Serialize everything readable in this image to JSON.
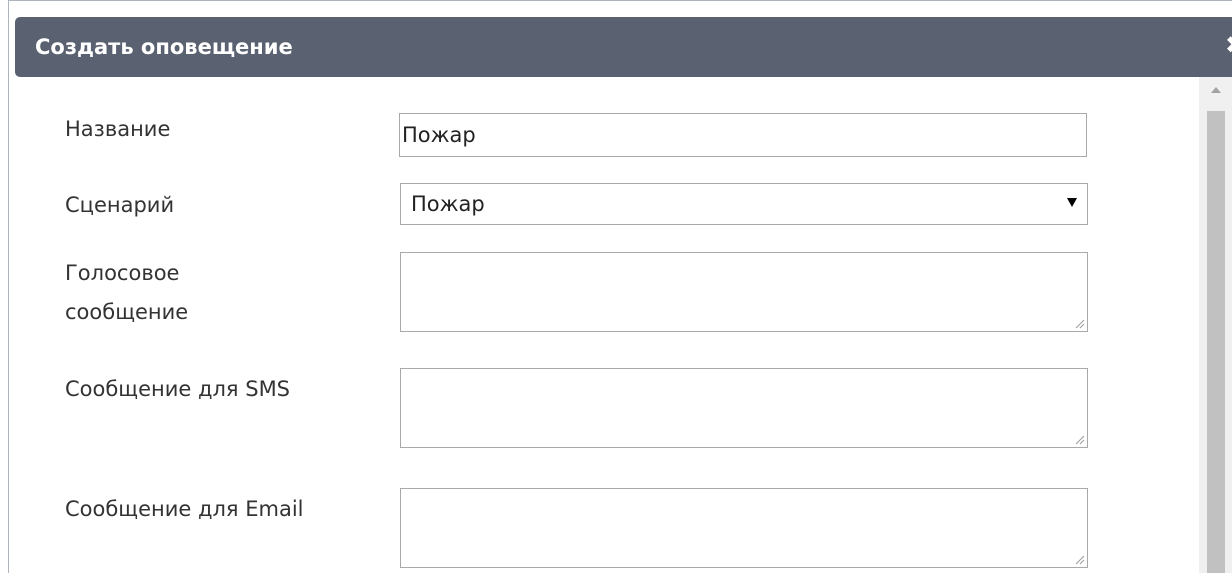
{
  "dialog": {
    "title": "Создать оповещение",
    "close_icon": "close-icon",
    "close_glyph": "✖"
  },
  "form": {
    "name": {
      "label": "Название",
      "value": "Пожар"
    },
    "scenario": {
      "label": "Сценарий",
      "selected": "Пожар"
    },
    "voice_message": {
      "label_line1": "Голосовое",
      "label_line2": "сообщение",
      "value": ""
    },
    "sms_message": {
      "label": "Сообщение для SMS",
      "value": ""
    },
    "email_message": {
      "label": "Сообщение для Email",
      "value": ""
    }
  },
  "colors": {
    "titlebar": "#5a6272",
    "title_text": "#ffffff",
    "border": "#a9a9a9"
  }
}
